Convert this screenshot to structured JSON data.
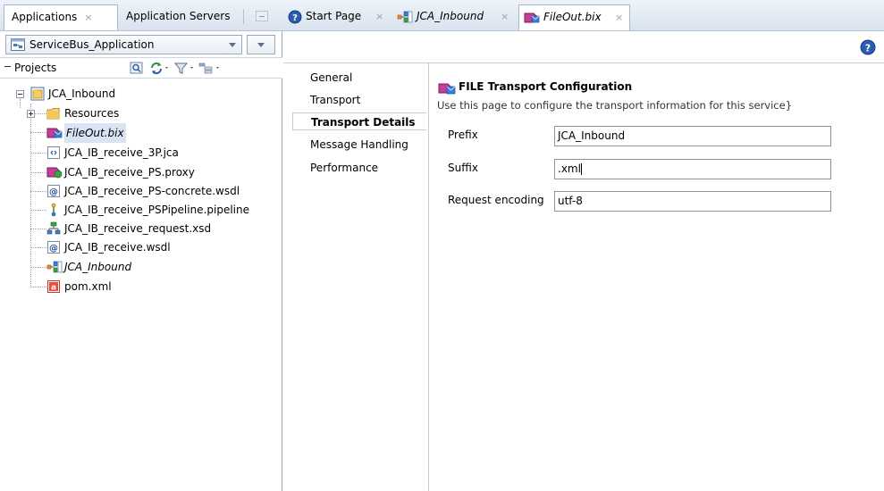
{
  "left_panel": {
    "tabs": [
      {
        "label": "Applications",
        "close": "×"
      },
      {
        "label": "Application Servers"
      }
    ],
    "application_selector": {
      "value": "ServiceBus_Application"
    },
    "projects_header": {
      "label": "Projects"
    },
    "tree": {
      "project": {
        "label": "JCA_Inbound",
        "expanded": true
      },
      "items": [
        {
          "label": "Resources",
          "icon": "folder-icon",
          "kind": "folder"
        },
        {
          "label": "FileOut.bix",
          "icon": "business-service-icon",
          "kind": "file",
          "selected": true,
          "italic": true
        },
        {
          "label": "JCA_IB_receive_3P.jca",
          "icon": "jca-file-icon",
          "kind": "file"
        },
        {
          "label": "JCA_IB_receive_PS.proxy",
          "icon": "proxy-service-icon",
          "kind": "file"
        },
        {
          "label": "JCA_IB_receive_PS-concrete.wsdl",
          "icon": "wsdl-icon",
          "kind": "file"
        },
        {
          "label": "JCA_IB_receive_PSPipeline.pipeline",
          "icon": "pipeline-icon",
          "kind": "file"
        },
        {
          "label": "JCA_IB_receive_request.xsd",
          "icon": "xsd-icon",
          "kind": "file"
        },
        {
          "label": "JCA_IB_receive.wsdl",
          "icon": "wsdl-icon",
          "kind": "file"
        },
        {
          "label": "JCA_Inbound",
          "icon": "composite-overview-icon",
          "kind": "file",
          "italic": true
        },
        {
          "label": "pom.xml",
          "icon": "maven-pom-icon",
          "kind": "file"
        }
      ]
    }
  },
  "editor": {
    "tabs": [
      {
        "label": "Start Page",
        "icon": "help-circle-icon"
      },
      {
        "label": "JCA_Inbound",
        "icon": "composite-overview-icon",
        "italic": true
      },
      {
        "label": "FileOut.bix",
        "icon": "business-service-icon",
        "italic": true,
        "active": true
      }
    ],
    "close_glyph": "×",
    "nav": {
      "items": [
        "General",
        "Transport",
        "Transport Details",
        "Message Handling",
        "Performance"
      ],
      "active_index": 2
    },
    "content": {
      "title": "FILE Transport Configuration",
      "description": "Use this page to configure the transport information for this service}",
      "fields": [
        {
          "label": "Prefix",
          "value": "JCA_Inbound"
        },
        {
          "label": "Suffix",
          "value": ".xml",
          "focused": true
        },
        {
          "label": "Request encoding",
          "value": "utf-8"
        }
      ]
    }
  },
  "colors": {
    "tab_strip": "#dbe4ee",
    "selection": "#d8e4f2",
    "help_blue": "#2a5db0",
    "folder": "#f0c85a",
    "bix_magenta": "#b0207c"
  }
}
